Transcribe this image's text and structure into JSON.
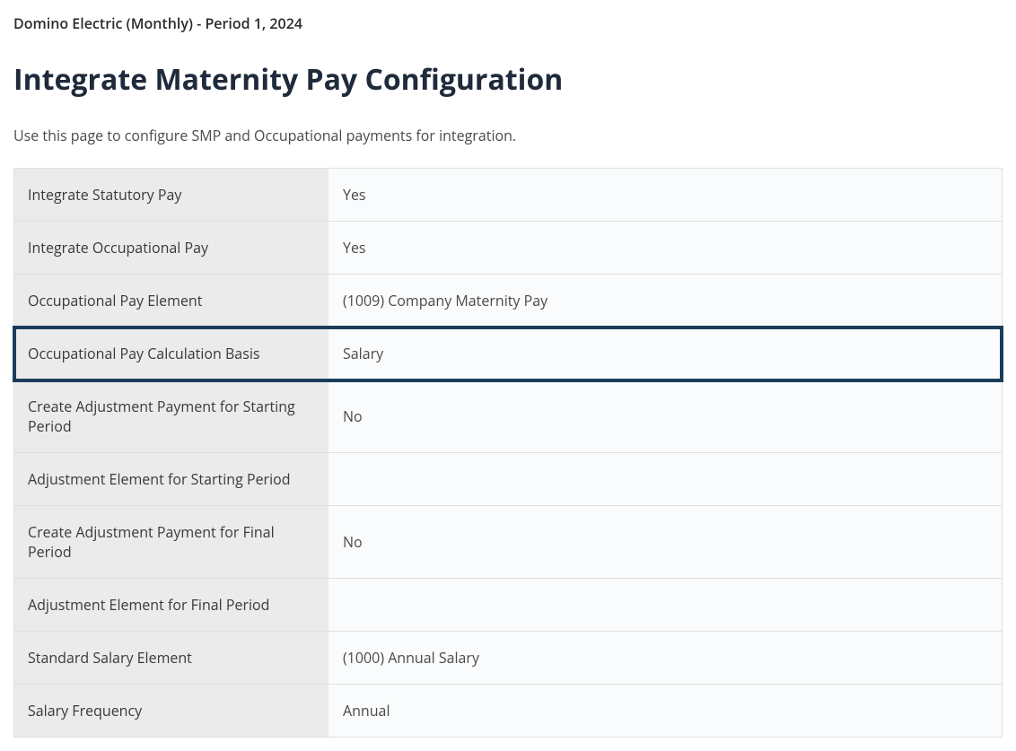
{
  "breadcrumb": "Domino Electric (Monthly) - Period 1, 2024",
  "title": "Integrate Maternity Pay Configuration",
  "description": "Use this page to configure SMP and Occupational payments for integration.",
  "rows": [
    {
      "label": "Integrate Statutory Pay",
      "value": "Yes"
    },
    {
      "label": "Integrate Occupational Pay",
      "value": "Yes"
    },
    {
      "label": "Occupational Pay Element",
      "value": "(1009) Company Maternity Pay"
    },
    {
      "label": "Occupational Pay Calculation Basis",
      "value": "Salary"
    },
    {
      "label": "Create Adjustment Payment for Starting Period",
      "value": "No"
    },
    {
      "label": "Adjustment Element for Starting Period",
      "value": ""
    },
    {
      "label": "Create Adjustment Payment for Final Period",
      "value": "No"
    },
    {
      "label": "Adjustment Element for Final Period",
      "value": ""
    },
    {
      "label": "Standard Salary Element",
      "value": "(1000) Annual Salary"
    },
    {
      "label": "Salary Frequency",
      "value": "Annual"
    }
  ]
}
